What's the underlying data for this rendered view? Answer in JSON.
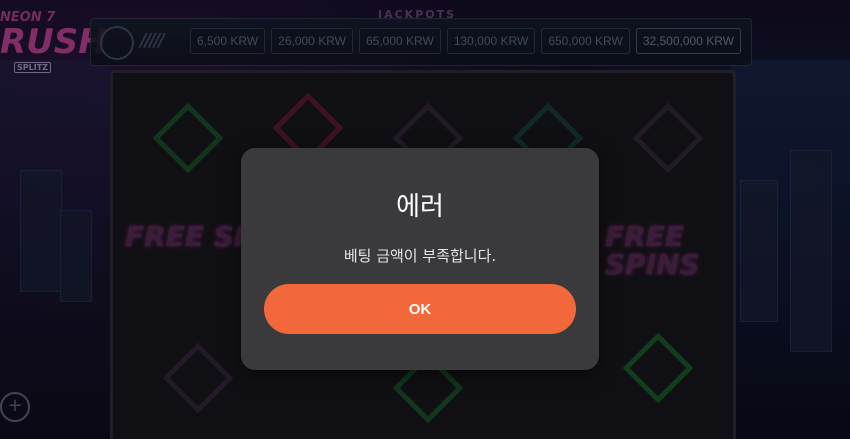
{
  "game": {
    "logo_line1": "NEON 7",
    "logo_line2": "RUSH",
    "logo_badge": "SPLITZ"
  },
  "jackpots": {
    "title": "JACKPOTS",
    "values": [
      "6,500 KRW",
      "26,000 KRW",
      "65,000 KRW",
      "130,000 KRW",
      "650,000 KRW",
      "32,500,000 KRW"
    ]
  },
  "reels": {
    "free_spins_label": "FREE SPINS"
  },
  "dialog": {
    "title": "에러",
    "message": "베팅 금액이 부족합니다.",
    "ok_label": "OK"
  },
  "colors": {
    "dialog_bg": "#3a3a3d",
    "ok_button": "#f2683a"
  }
}
